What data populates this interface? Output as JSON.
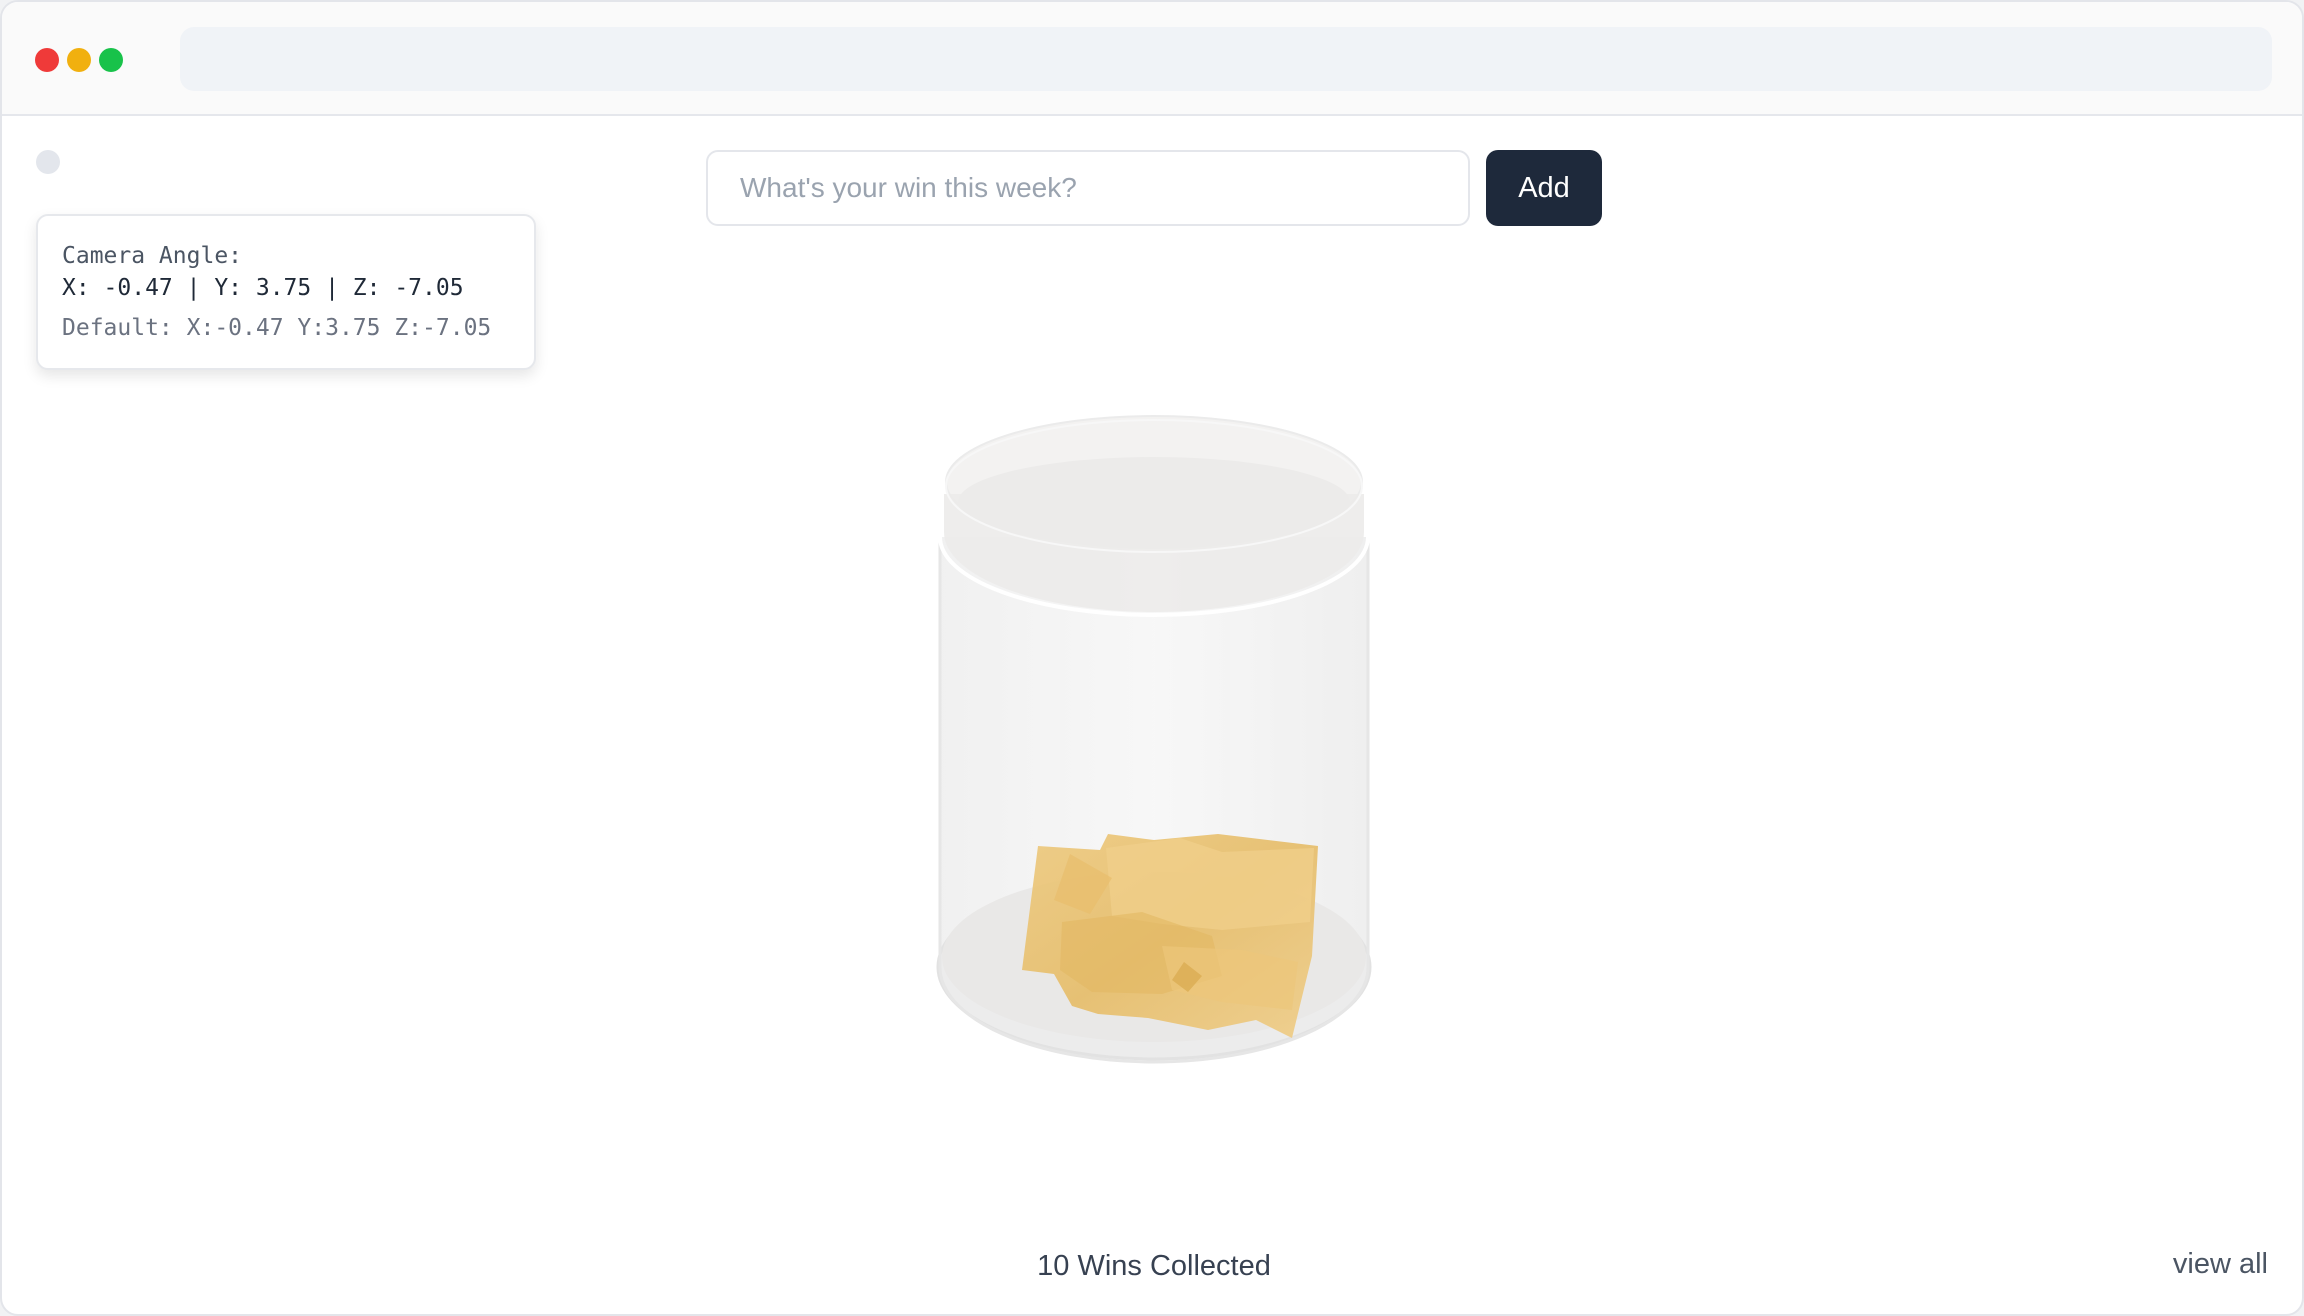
{
  "camera": {
    "title": "Camera Angle:",
    "values": "X: -0.47 | Y: 3.75 | Z: -7.05",
    "default": "Default: X:-0.47 Y:3.75 Z:-7.05"
  },
  "form": {
    "placeholder": "What's your win this week?",
    "value": "",
    "add_label": "Add"
  },
  "footer": {
    "count_label": "10 Wins Collected",
    "view_all_label": "view all"
  },
  "icons": {
    "window_controls": [
      "close-icon",
      "minimize-icon",
      "maximize-icon"
    ]
  },
  "colors": {
    "button_bg": "#1e293b",
    "note_color": "#e8c06e",
    "close": "#ef3a39",
    "minimize": "#f1b00f",
    "maximize": "#18c24a"
  }
}
